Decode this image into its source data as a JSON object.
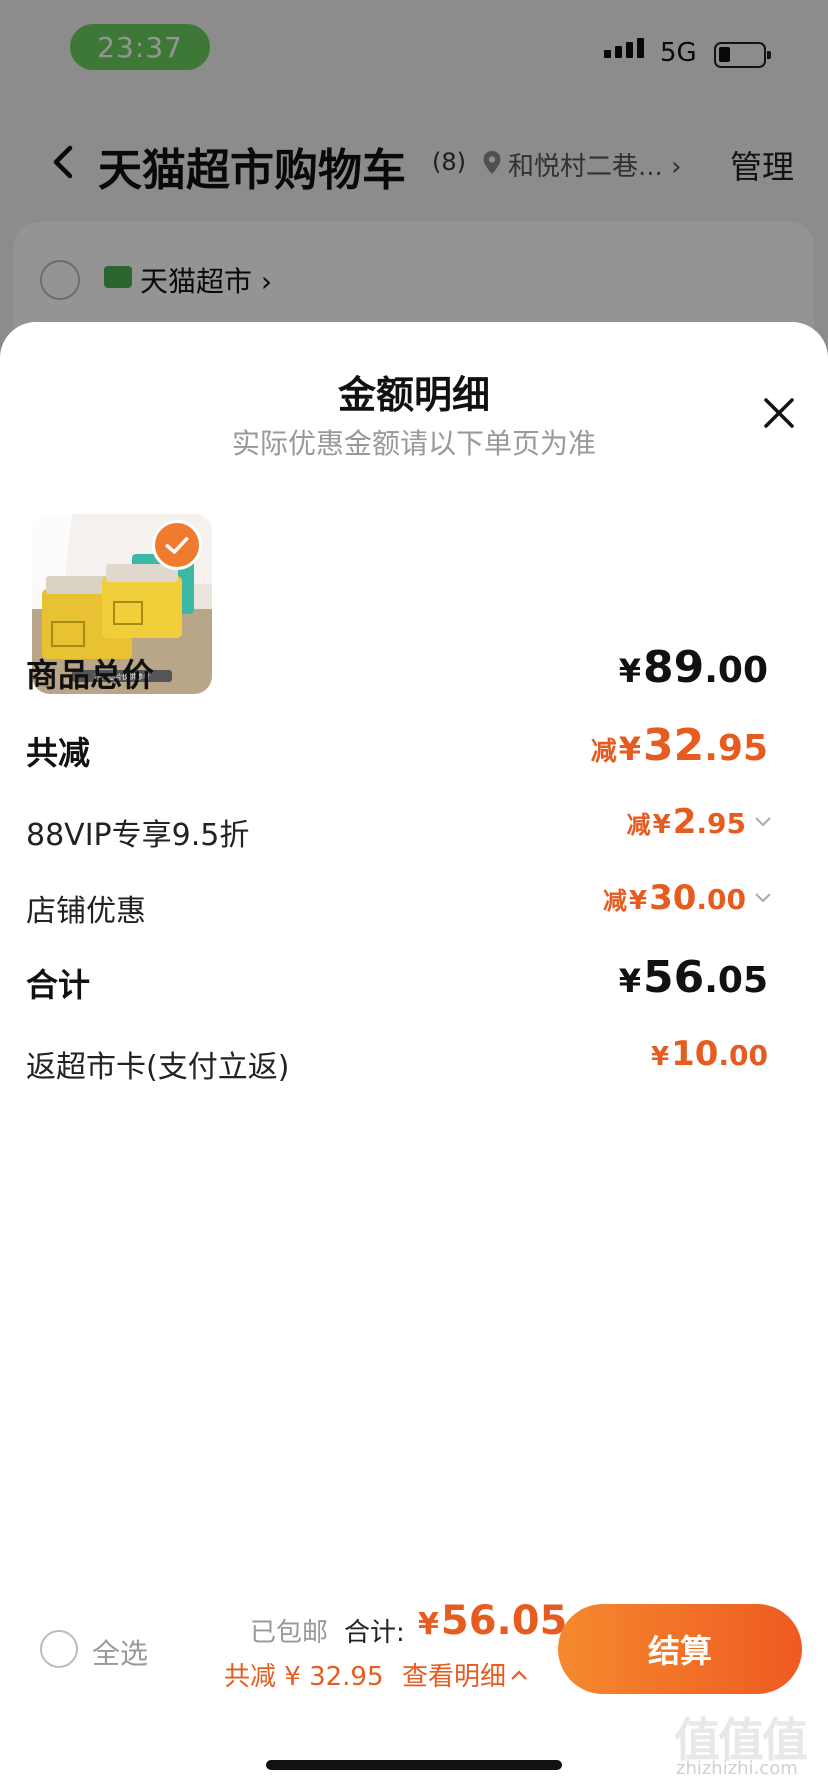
{
  "status_bar": {
    "time": "23:37",
    "network": "5G"
  },
  "nav": {
    "title": "天猫超市购物车",
    "count": "(8)",
    "address": "和悦村二巷...",
    "manage": "管理"
  },
  "store": {
    "name": "天猫超市"
  },
  "sheet": {
    "title": "金额明细",
    "subtitle": "实际优惠金额请以下单页为准",
    "product_image_caption": "注：图片仅供参考",
    "rows": {
      "goods_total": {
        "label": "商品总价",
        "yen": "¥",
        "int": "89",
        "dec": ".00"
      },
      "total_reduction": {
        "label": "共减",
        "prefix": "减",
        "yen": "¥",
        "int": "32",
        "dec": ".95"
      },
      "vip_discount": {
        "label": "88VIP专享9.5折",
        "prefix": "减",
        "yen": "¥",
        "int": "2",
        "dec": ".95"
      },
      "store_discount": {
        "label": "店铺优惠",
        "prefix": "减",
        "yen": "¥",
        "int": "30",
        "dec": ".00"
      },
      "subtotal": {
        "label": "合计",
        "yen": "¥",
        "int": "56",
        "dec": ".05"
      },
      "cashback": {
        "label": "返超市卡(支付立返)",
        "yen": "¥",
        "int": "10",
        "dec": ".00"
      }
    }
  },
  "bottom_bar": {
    "select_all": "全选",
    "shipped": "已包邮",
    "total_label": "合计:",
    "total_yen": "¥",
    "total_value": "56.05",
    "saved": "共减 ¥ 32.95",
    "view_detail": "查看明细",
    "checkout": "结算"
  },
  "watermark": {
    "text": "值值值",
    "sub": "zhizhizhi.com"
  },
  "colors": {
    "accent_orange": "#e65c20",
    "button_gradient_start": "#f5892f",
    "button_gradient_end": "#ee5a21",
    "time_pill": "#6ccf5f"
  }
}
